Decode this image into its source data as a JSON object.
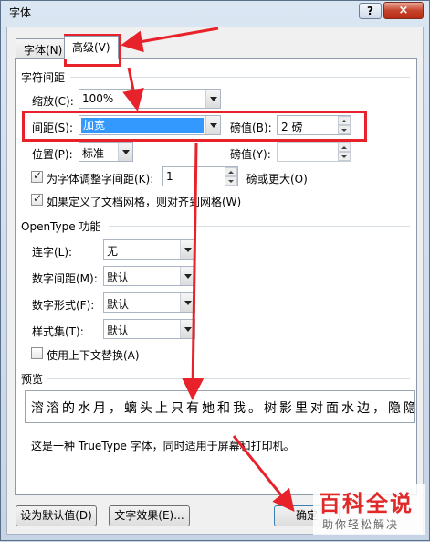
{
  "window": {
    "title": "字体",
    "help_label": "?",
    "close_label": "×"
  },
  "tabs": [
    {
      "label": "字体(N)",
      "active": false
    },
    {
      "label": "高级(V)",
      "active": true
    }
  ],
  "character_spacing": {
    "group_title": "字符间距",
    "scale": {
      "label": "缩放(C):",
      "value": "100%"
    },
    "spacing": {
      "label": "间距(S):",
      "value": "加宽",
      "amount_label": "磅值(B):",
      "amount": "2 磅"
    },
    "position": {
      "label": "位置(P):",
      "value": "标准",
      "amount_label": "磅值(Y):",
      "amount": ""
    },
    "kerning": {
      "label": "为字体调整字间距(K):",
      "checked": true,
      "value": "1",
      "suffix": "磅或更大(O)"
    },
    "snap_to_grid": {
      "label": "如果定义了文档网格，则对齐到网格(W)",
      "checked": true
    }
  },
  "opentype": {
    "group_title": "OpenType 功能",
    "ligatures": {
      "label": "连字(L):",
      "value": "无"
    },
    "number_spacing": {
      "label": "数字间距(M):",
      "value": "默认"
    },
    "number_forms": {
      "label": "数字形式(F):",
      "value": "默认"
    },
    "stylistic_sets": {
      "label": "样式集(T):",
      "value": "默认"
    },
    "contextual_alternates": {
      "label": "使用上下文替换(A)",
      "checked": false
    }
  },
  "preview": {
    "group_title": "预览",
    "sample": "溶溶的水月，螭头上只有她和我。树影里对面水边，隐隐",
    "description": "这是一种 TrueType 字体，同时适用于屏幕和打印机。"
  },
  "buttons": {
    "set_default": "设为默认值(D)",
    "text_effects": "文字效果(E)...",
    "ok": "确定"
  },
  "watermark": {
    "main": "百科全说",
    "sub": "助你轻松解决"
  },
  "colors": {
    "annotation": "#e8222a",
    "selection": "#3399ff",
    "watermark": "#e02a2a"
  }
}
